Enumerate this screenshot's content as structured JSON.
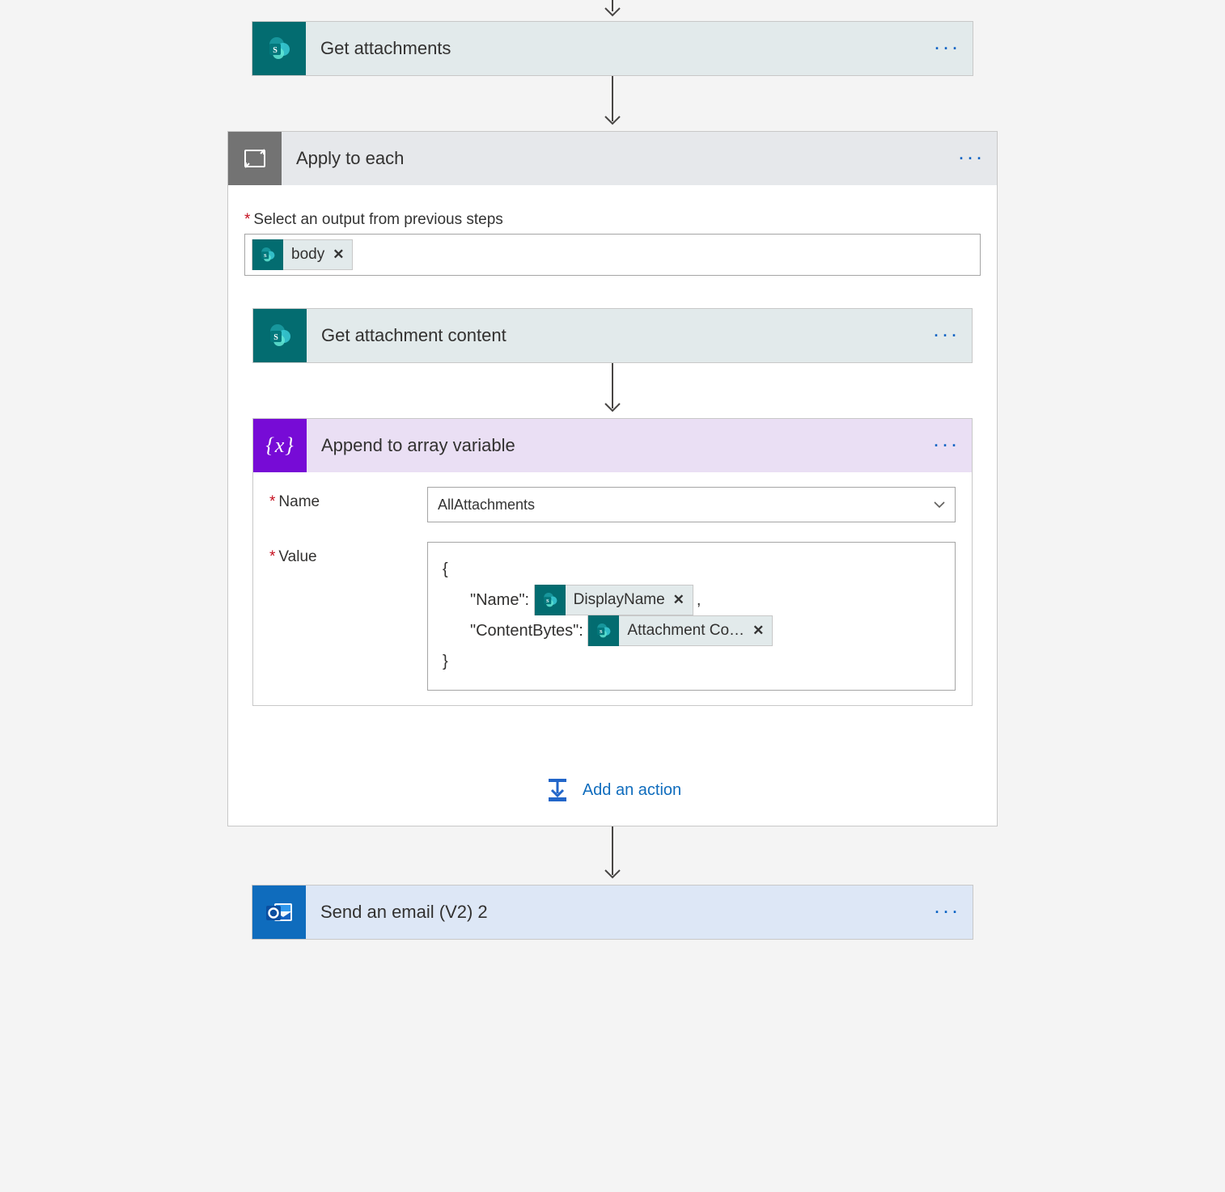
{
  "flow": {
    "step_get_attachments": {
      "title": "Get attachments"
    },
    "apply_to_each": {
      "title": "Apply to each",
      "select_output_label": "Select an output from previous steps",
      "select_output_token": "body",
      "step_get_content": {
        "title": "Get attachment content"
      },
      "step_append": {
        "title": "Append to array variable",
        "params": {
          "name_label": "Name",
          "name_value": "AllAttachments",
          "value_label": "Value",
          "value_code": {
            "open": "{",
            "line1_key": "\"Name\":",
            "line1_token": "DisplayName",
            "line1_comma": ",",
            "line2_key": "\"ContentBytes\":",
            "line2_token": "Attachment Co…",
            "close": "}"
          }
        }
      },
      "add_action_label": "Add an action"
    },
    "step_send_email": {
      "title": "Send an email (V2) 2"
    }
  }
}
